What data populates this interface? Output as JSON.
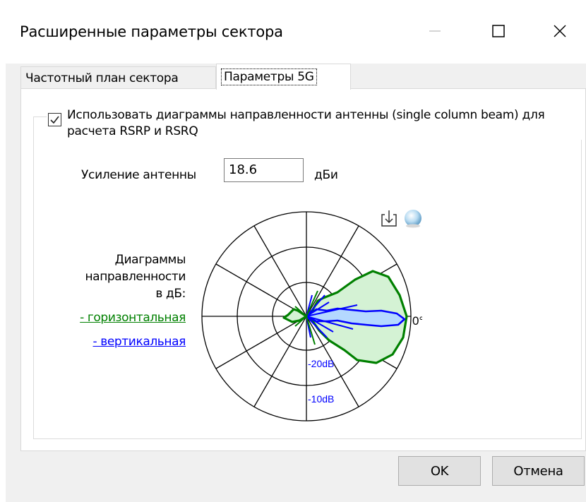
{
  "window": {
    "title": "Расширенные параметры сектора",
    "min_icon": "minimize-icon",
    "max_icon": "maximize-icon",
    "close_icon": "close-icon"
  },
  "tabs": [
    {
      "label": "Частотный план сектора",
      "active": false
    },
    {
      "label": "Параметры 5G",
      "active": true
    }
  ],
  "options": {
    "use_patterns_label": "Использовать диаграммы направленности антенны (single column beam) для расчета RSRP и RSRQ",
    "use_patterns_checked": true
  },
  "gain": {
    "label": "Усиление антенны",
    "value": "18.6",
    "unit": "дБи"
  },
  "legend": {
    "line1": "Диаграммы",
    "line2": "направленности",
    "line3": "в дБ:",
    "horizontal": "- горизонтальная",
    "vertical": "- вертикальная"
  },
  "chart_data": {
    "type": "polar",
    "angle_label": "0°",
    "ring_labels": [
      "-20dB",
      "-10dB"
    ],
    "colors": {
      "horizontal": "#008000",
      "horizontal_fill": "#d4f2d4",
      "vertical": "#0000ff",
      "vertical_fill": "#b4d8ff"
    },
    "series": [
      {
        "name": "- горизонтальная",
        "color": "#008000"
      },
      {
        "name": "- вертикальная",
        "color": "#0000ff"
      }
    ]
  },
  "icons": {
    "save": "save-download-icon",
    "view3d": "globe-3d-icon"
  },
  "buttons": {
    "ok": "OK",
    "cancel": "Отмена"
  }
}
